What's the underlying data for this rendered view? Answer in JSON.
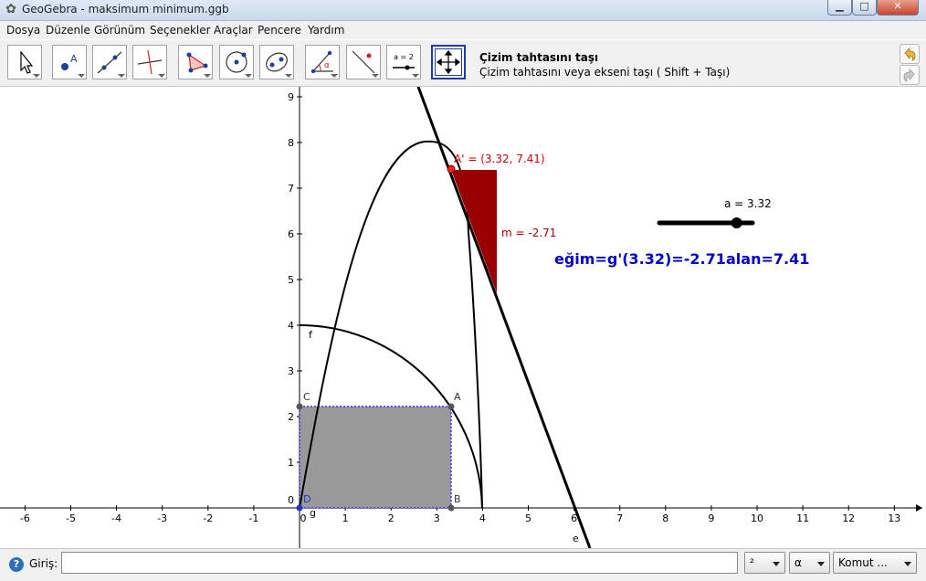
{
  "window": {
    "title": "GeoGebra - maksimum minimum.ggb",
    "app_icon": "geogebra-logo-icon",
    "buttons": [
      "minimize-icon",
      "maximize-icon",
      "close-icon"
    ]
  },
  "menu": {
    "items": [
      "Dosya",
      "Düzenle",
      "Görünüm",
      "Seçenekler",
      "Araçlar",
      "Pencere",
      "Yardım"
    ]
  },
  "toolbar": {
    "tools": [
      {
        "name": "move-tool-icon"
      },
      {
        "name": "point-tool-icon"
      },
      {
        "name": "line-tool-icon"
      },
      {
        "name": "perpendicular-line-tool-icon"
      },
      {
        "name": "polygon-tool-icon"
      },
      {
        "name": "circle-tool-icon"
      },
      {
        "name": "conic-tool-icon"
      },
      {
        "name": "angle-tool-icon"
      },
      {
        "name": "reflect-tool-icon"
      },
      {
        "name": "slider-tool-icon",
        "label": "a = 2"
      },
      {
        "name": "move-graphics-view-icon"
      }
    ],
    "selected_tool_name": "Çizim tahtasını taşı",
    "selected_tool_help": "Çizim tahtasını veya ekseni taşı ( Shift + Taşı)",
    "undo_icon": "undo-icon",
    "redo_icon": "redo-icon"
  },
  "graphics": {
    "x_ticks": [
      "-6",
      "-5",
      "-4",
      "-3",
      "-2",
      "-1",
      "0",
      "1",
      "2",
      "3",
      "4",
      "5",
      "6",
      "7",
      "8",
      "9",
      "10",
      "11",
      "12",
      "13"
    ],
    "y_ticks": [
      "1",
      "2",
      "3",
      "4",
      "5",
      "6",
      "7",
      "8",
      "9"
    ],
    "origin_label": "0",
    "point_labels": {
      "A": "A",
      "B": "B",
      "C": "C",
      "D": "D"
    },
    "point_a_prime": "A' = (3.32, 7.41)",
    "slope_label": "m = -2.71",
    "curve_labels": {
      "f": "f",
      "g": "g",
      "e": "e"
    },
    "slider_label": "a = 3.32",
    "slider_value": 3.32,
    "slider_range": [
      0,
      4
    ],
    "text_slope": "eğim=g'(3.32)=-2.71",
    "text_area": "alan=7.41",
    "colors": {
      "blue_text": "#0000cc",
      "red": "#aa0000",
      "rect_fill": "#999999",
      "rect_border": "#0000ff"
    }
  },
  "inputbar": {
    "help_icon": "help-icon",
    "label": "Giriş:",
    "value": "",
    "combo_superscript": "²",
    "combo_greek": "α",
    "combo_command": "Komut ..."
  }
}
